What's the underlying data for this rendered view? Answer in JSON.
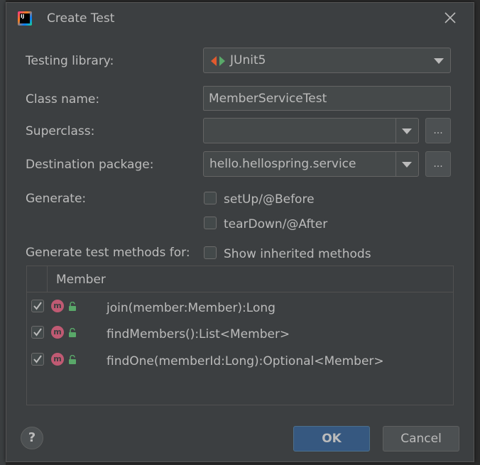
{
  "dialog": {
    "title": "Create Test",
    "app_icon_text": "IJ"
  },
  "form": {
    "testing_library_label": "Testing library:",
    "testing_library_value": "JUnit5",
    "class_name_label": "Class name:",
    "class_name_value": "MemberServiceTest",
    "superclass_label": "Superclass:",
    "superclass_value": "",
    "destination_package_label": "Destination package:",
    "destination_package_value": "hello.hellospring.service",
    "browse_label": "...",
    "generate_label": "Generate:",
    "setup_label": "setUp/@Before",
    "setup_checked": false,
    "teardown_label": "tearDown/@After",
    "teardown_checked": false,
    "generate_methods_label": "Generate test methods for:",
    "show_inherited_label": "Show inherited methods",
    "show_inherited_checked": false
  },
  "table": {
    "header": "Member",
    "method_badge": "m",
    "rows": [
      {
        "checked": true,
        "label": "join(member:Member):Long"
      },
      {
        "checked": true,
        "label": "findMembers():List<Member>"
      },
      {
        "checked": true,
        "label": "findOne(memberId:Long):Optional<Member>"
      }
    ]
  },
  "buttons": {
    "help": "?",
    "ok": "OK",
    "cancel": "Cancel"
  },
  "colors": {
    "dialog_bg": "#3c3f41",
    "field_bg": "#45494a",
    "ok_bg": "#365880",
    "method_badge": "#c05a73",
    "lock_icon": "#59a869",
    "junit_left": "#e15a2e",
    "junit_right": "#59a869"
  },
  "icons": {
    "library": "junit-icon",
    "close": "close-icon",
    "method": "method-icon",
    "visibility": "public-lock-icon"
  }
}
